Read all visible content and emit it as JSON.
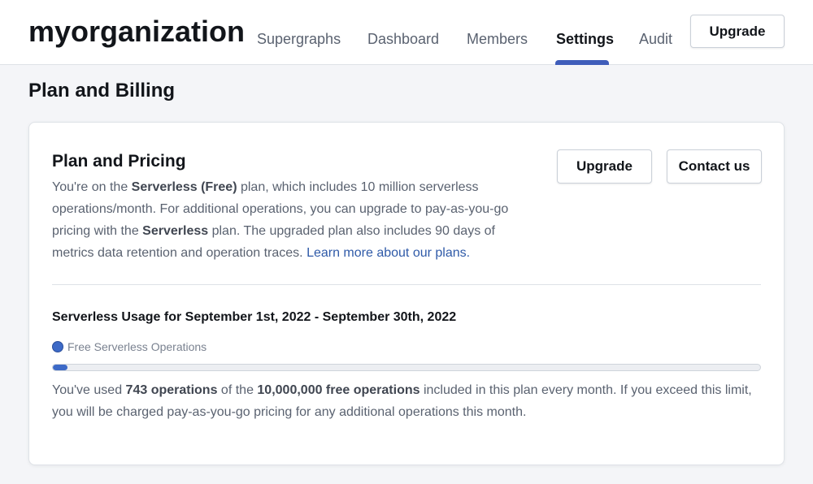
{
  "header": {
    "org_name": "myorganization",
    "nav": [
      {
        "label": "Supergraphs",
        "active": false
      },
      {
        "label": "Dashboard",
        "active": false
      },
      {
        "label": "Members",
        "active": false
      },
      {
        "label": "Settings",
        "active": true
      },
      {
        "label": "Audit",
        "active": false
      }
    ],
    "upgrade_label": "Upgrade"
  },
  "page": {
    "title": "Plan and Billing"
  },
  "plan_card": {
    "title": "Plan and Pricing",
    "desc_1": "You're on the ",
    "desc_plan": "Serverless (Free)",
    "desc_2": " plan, which includes 10 million serverless operations/month. For additional operations, you can upgrade to pay-as-you-go pricing with the ",
    "desc_serverless": "Serverless",
    "desc_3": " plan. The upgraded plan also includes 90 days of metrics data retention and operation traces. ",
    "learn_more": "Learn more about our plans.",
    "upgrade_label": "Upgrade",
    "contact_label": "Contact us"
  },
  "usage": {
    "title": "Serverless Usage for September 1st, 2022 - September 30th, 2022",
    "legend_label": "Free Serverless Operations",
    "legend_color": "#3d6ac7",
    "used_operations": 743,
    "limit_operations": 10000000,
    "progress_percent": 0.0074,
    "text_1": "You've used ",
    "text_used": "743 operations",
    "text_2": " of the ",
    "text_limit": "10,000,000 free operations",
    "text_3": " included in this plan every month. If you exceed this limit, you will be charged pay-as-you-go pricing for any additional operations this month."
  }
}
